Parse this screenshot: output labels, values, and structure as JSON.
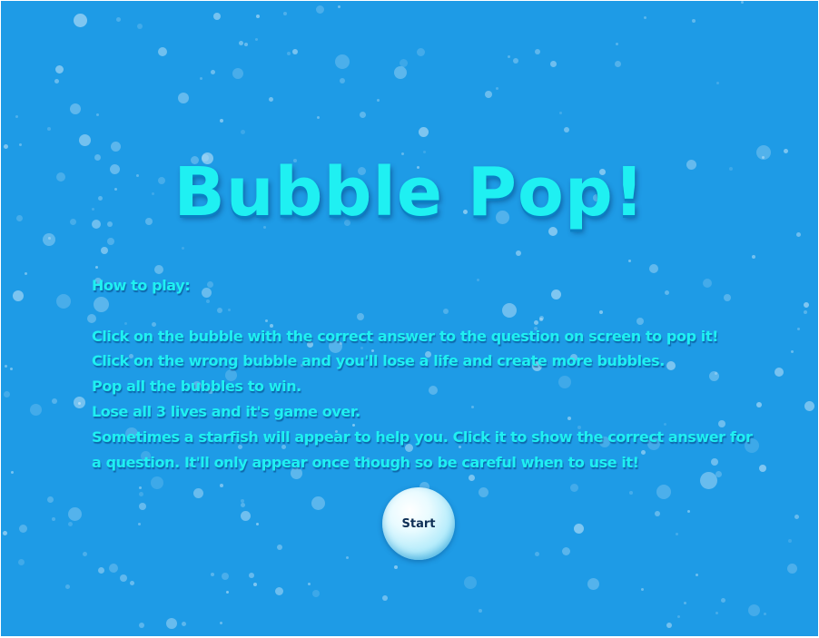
{
  "game": {
    "title": "Bubble Pop!",
    "instructions": {
      "heading": "How to play:",
      "lines": [
        "Click on the bubble with the correct answer to the question on screen to pop it!",
        "Click on the wrong bubble and you'll lose a life and create more bubbles.",
        "Pop all the bubbles to win.",
        "Lose all 3 lives and it's game over.",
        "Sometimes a starfish will appear to help you. Click it to show the correct answer for",
        "a question. It'll only appear once though so be careful when to use it!"
      ]
    },
    "start_label": "Start"
  },
  "colors": {
    "background": "#1e9be6",
    "title_text": "#1ff0f2",
    "start_text": "#0d2f55"
  }
}
